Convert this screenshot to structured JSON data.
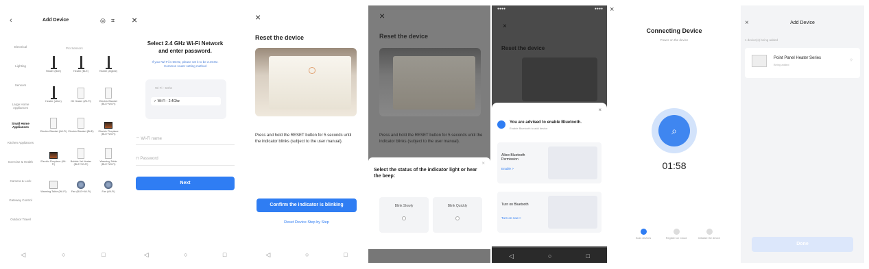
{
  "panel1": {
    "back_icon": "chevron-left-icon",
    "title": "Add Device",
    "categories": [
      "Electrical",
      "Lighting",
      "Sensors",
      "Large Home Appliances",
      "Small Home Appliances",
      "Kitchen Appliances",
      "Exercise & Health",
      "Camera & Lock",
      "Gateway Control",
      "Outdoor Travel"
    ],
    "active_category": 4,
    "grid_title": "Pro Sensors",
    "devices": [
      {
        "label": "Heater (BLE)",
        "icon": "lamp"
      },
      {
        "label": "Heater (BLE)",
        "icon": "lamp"
      },
      {
        "label": "Heater (Zigbee)",
        "icon": "lamp"
      },
      {
        "label": "Heater (other)",
        "icon": "lamp"
      },
      {
        "label": "Oil Heater (Wi-Fi)",
        "icon": "panel"
      },
      {
        "label": "Electric Blanket (BLE+Wi-Fi)",
        "icon": "panel"
      },
      {
        "label": "Electric Blanket (Wi-Fi)",
        "icon": "panel"
      },
      {
        "label": "Electric Blanket (BLE)",
        "icon": "panel"
      },
      {
        "label": "Electric Fireplace (BLE+Wi-Fi)",
        "icon": "fire"
      },
      {
        "label": "Electric Fireplace (Wi-Fi)",
        "icon": "fire"
      },
      {
        "label": "Bubble Jet Heater (BLE+Wi-Fi)",
        "icon": "panel"
      },
      {
        "label": "Warming Table (BLE+Wi-Fi)",
        "icon": "panel"
      },
      {
        "label": "Warming Table (Wi-Fi)",
        "icon": "bigpanel"
      },
      {
        "label": "Fan (BLE+Wi-Fi)",
        "icon": "fan"
      },
      {
        "label": "Fan (Wi-Fi)",
        "icon": "fan"
      }
    ]
  },
  "panel2": {
    "close_icon": "close-icon",
    "title_line1": "Select 2.4 GHz Wi-Fi Network",
    "title_line2": "and enter password.",
    "sub_line1": "If your Wi-Fi is 5GHz, please set it to be 2.4GHz.",
    "sub_line2": "Common router setting method",
    "wifi_5g": "Wi-Fi - 5Ghz",
    "wifi_24g": "Wi-Fi - 2.4Ghz",
    "wifi_name_placeholder": "Wi-Fi name",
    "password_placeholder": "Password",
    "next_label": "Next"
  },
  "panel3": {
    "close_icon": "close-icon",
    "title": "Reset the device",
    "description": "Press and hold the RESET button for 5 seconds until the indicator blinks (subject to the user manual).",
    "confirm_label": "Confirm the indicator is blinking",
    "reset_link": "Reset Device Step by Step"
  },
  "panel4": {
    "close_icon": "close-icon",
    "title": "Reset the device",
    "description": "Press and hold the RESET button for 5 seconds until the indicator blinks (subject to the user manual).",
    "sheet_question": "Select the status of the indicator light or hear the beep:",
    "option1": "Blink Slowly",
    "option2": "Blink Quickly"
  },
  "panel5": {
    "close_icon": "close-icon",
    "title": "Reset the device",
    "bt_title": "You are advised to enable Bluetooth.",
    "bt_sub": "Enable Bluetooth to add device",
    "step1_title": "Allow Bluetooth Permission",
    "step1_link": "Enable >",
    "step2_title": "Turn on Bluetooth",
    "step2_link": "Turn on now >"
  },
  "outer_close_icon": "close-icon",
  "panel6": {
    "title": "Connecting Device",
    "subtitle": "Power on the device",
    "search_icon": "search-icon",
    "timer": "01:58",
    "steps": [
      "Scan devices",
      "Register on Cloud",
      "Initialize the device"
    ]
  },
  "panel7": {
    "close_icon": "close-icon",
    "title": "Add Device",
    "section": "1 device(s) being added",
    "device_name": "Point Panel Heater Series",
    "device_status": "Being added",
    "done_label": "Done"
  },
  "colors": {
    "accent": "#2f7df3",
    "ring_light": "#d3e3fb"
  }
}
